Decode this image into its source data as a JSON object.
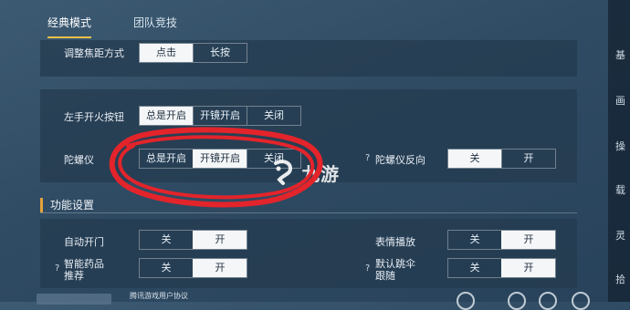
{
  "tabs": [
    {
      "label": "经典模式",
      "active": true
    },
    {
      "label": "团队竞技",
      "active": false
    }
  ],
  "right_rail": [
    "基",
    "画",
    "操",
    "载",
    "灵",
    "拾"
  ],
  "focus_mode": {
    "label": "调整焦距方式",
    "options": [
      "点击",
      "长按"
    ],
    "selected": 0
  },
  "left_fire": {
    "label": "左手开火按钮",
    "options": [
      "总是开启",
      "开镜开启",
      "关闭"
    ],
    "selected": 0
  },
  "gyro": {
    "label": "陀螺仪",
    "options": [
      "总是开启",
      "开镜开启",
      "关闭"
    ],
    "selected": 1
  },
  "gyro_reverse": {
    "help": "?",
    "label": "陀螺仪反向",
    "options": [
      "关",
      "开"
    ],
    "selected": 0
  },
  "section": {
    "title": "功能设置"
  },
  "auto_door": {
    "label": "自动开门",
    "options": [
      "关",
      "开"
    ],
    "selected": 1
  },
  "emote": {
    "label": "表情播放",
    "options": [
      "关",
      "开"
    ],
    "selected": 1
  },
  "smart_med": {
    "help": "?",
    "label_line1": "智能药品",
    "label_line2": "推荐",
    "options": [
      "关",
      "开"
    ],
    "selected": 1
  },
  "default_jump": {
    "help": "?",
    "label_line1": "默认跳伞",
    "label_line2": "跟随",
    "options": [
      "关",
      "开"
    ],
    "selected": 1
  },
  "watermark": {
    "text": "九游",
    "icon": "jiuyou-logo-icon"
  },
  "annotation": {
    "color": "#e3242b"
  },
  "footer": {
    "text": "腾讯游戏用户协议"
  },
  "colors": {
    "accent": "#e9c14a",
    "section_marker": "#e2a23a",
    "selected_bg": "#f4f6f8"
  }
}
